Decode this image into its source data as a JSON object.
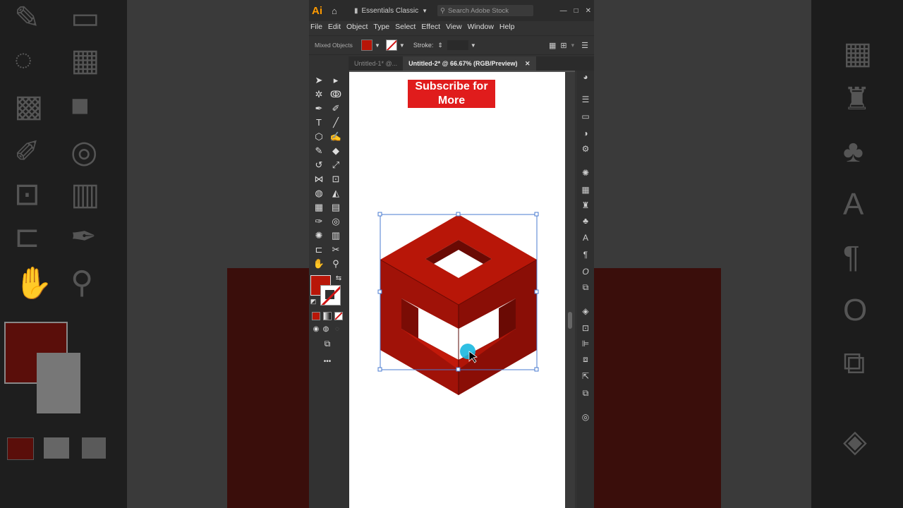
{
  "app": {
    "logo": "Ai",
    "workspace": "Essentials Classic",
    "search_placeholder": "Search Adobe Stock",
    "window_buttons": [
      "—",
      "□",
      "✕"
    ]
  },
  "menu": [
    "File",
    "Edit",
    "Object",
    "Type",
    "Select",
    "Effect",
    "View",
    "Window",
    "Help"
  ],
  "control_bar": {
    "selection_label": "Mixed Objects",
    "fill_color": "#b81608",
    "stroke_label": "Stroke:"
  },
  "tabs": [
    {
      "label": "Untitled-1* @...",
      "active": false
    },
    {
      "label": "Untitled-2* @ 66.67% (RGB/Preview)",
      "active": true
    }
  ],
  "tab_close": "✕",
  "overlay": {
    "subscribe_line1": "Subscribe for",
    "subscribe_line2": "More"
  },
  "colors": {
    "accent_red": "#b81608",
    "selection_blue": "#4a7bd0",
    "cursor_highlight": "#18b8e0"
  },
  "more_tools": "•••"
}
